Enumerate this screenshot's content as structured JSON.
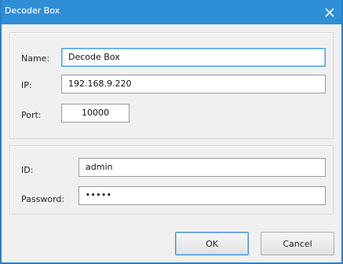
{
  "window": {
    "title": "Decoder Box",
    "close_icon": "close-icon",
    "title_bar_color": "#2e8ed6"
  },
  "device": {
    "name_label": "Name:",
    "name_value": "Decode Box",
    "ip_label": "IP:",
    "ip_value": "192.168.9.220",
    "port_label": "Port:",
    "port_value": "10000"
  },
  "credentials": {
    "id_label": "ID:",
    "id_value": "admin",
    "password_label": "Password:",
    "password_value": "•••••"
  },
  "buttons": {
    "ok_label": "OK",
    "cancel_label": "Cancel"
  }
}
